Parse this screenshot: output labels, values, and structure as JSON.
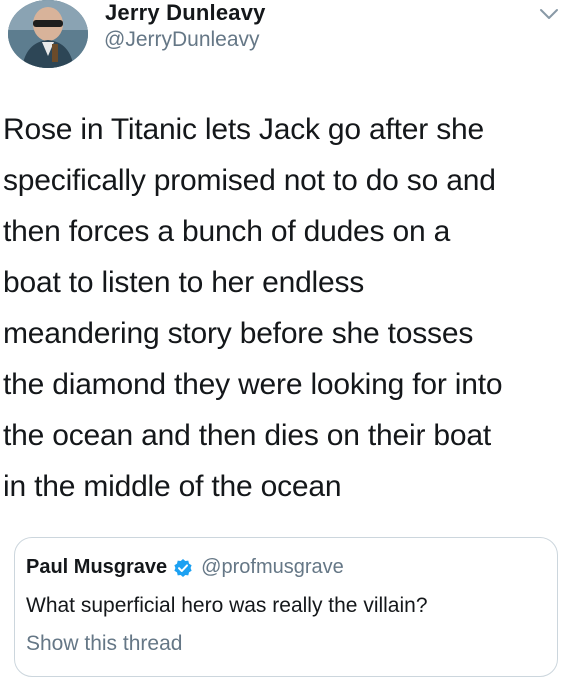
{
  "tweet": {
    "author_name": "Jerry Dunleavy",
    "author_handle": "@JerryDunleavy",
    "avatar_icon": "profile-photo",
    "menu_icon": "chevron-down-icon",
    "text": "Rose in Titanic lets Jack go after she\nspecifically promised not to do so and\nthen forces a bunch of dudes on a\nboat to listen to her endless\nmeandering story before she tosses\nthe diamond they were looking for into\nthe ocean and then dies on their boat\nin the middle of the ocean"
  },
  "quote": {
    "author_name": "Paul Musgrave",
    "verified_icon": "verified-badge-icon",
    "author_handle": "@profmusgrave",
    "text": "What superficial hero was really the villain?",
    "show_thread": "Show this thread"
  },
  "colors": {
    "text": "#14171a",
    "secondary": "#657786",
    "border": "#ccd6dd",
    "verified": "#1da1f2"
  }
}
